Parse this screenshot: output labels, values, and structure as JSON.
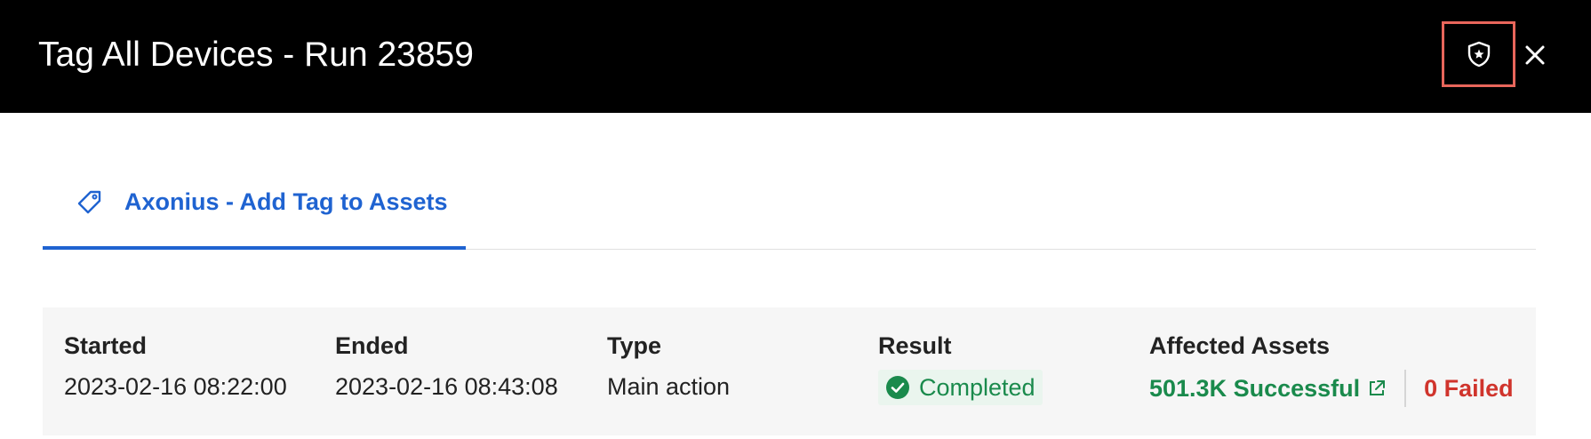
{
  "header": {
    "title": "Tag All Devices - Run 23859",
    "shield_icon": "shield-star-icon",
    "close_icon": "close-icon"
  },
  "tab": {
    "label": "Axonius - Add Tag to Assets",
    "icon": "tag-icon"
  },
  "summary": {
    "started": {
      "label": "Started",
      "value": "2023-02-16 08:22:00"
    },
    "ended": {
      "label": "Ended",
      "value": "2023-02-16 08:43:08"
    },
    "type": {
      "label": "Type",
      "value": "Main action"
    },
    "result": {
      "label": "Result",
      "value": "Completed",
      "icon": "check-circle-icon"
    },
    "affected": {
      "label": "Affected Assets",
      "successful": "501.3K Successful",
      "failed": "0 Failed",
      "link_icon": "external-link-icon"
    }
  },
  "colors": {
    "header_bg": "#000000",
    "accent": "#1f63d1",
    "success": "#1a8a4c",
    "error": "#d0342c",
    "highlight": "#e8665b"
  }
}
